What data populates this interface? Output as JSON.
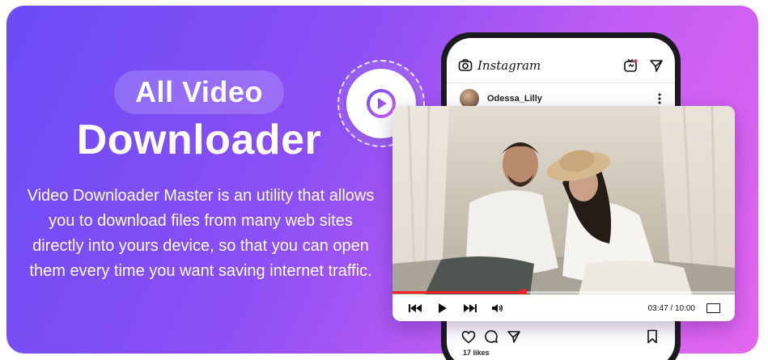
{
  "hero": {
    "title_pill": "All Video",
    "title_main": "Downloader",
    "description": "Video Downloader Master is an utility that allows you to download files from many web sites directly into yours device, so that you can open them every time you want saving internet traffic."
  },
  "colors": {
    "gradient_start": "#6a4cf6",
    "gradient_end": "#e467f0",
    "play_accent": "#8a3ff0",
    "progress_red": "#ff1f1f"
  },
  "phone": {
    "app_name": "Instagram",
    "username": "Odessa_Lilly",
    "likes": "17 likes",
    "icons": [
      "camera-icon",
      "igtv-icon",
      "direct-message-icon",
      "more-options-icon",
      "heart-icon",
      "comment-icon",
      "share-icon",
      "bookmark-icon"
    ]
  },
  "player": {
    "current_time": "03:47",
    "total_time": "10:00",
    "time_display": "03:47 / 10:00",
    "progress": 0.38,
    "icons": [
      "skip-back-icon",
      "play-icon",
      "skip-forward-icon",
      "volume-icon",
      "fullscreen-icon"
    ]
  }
}
